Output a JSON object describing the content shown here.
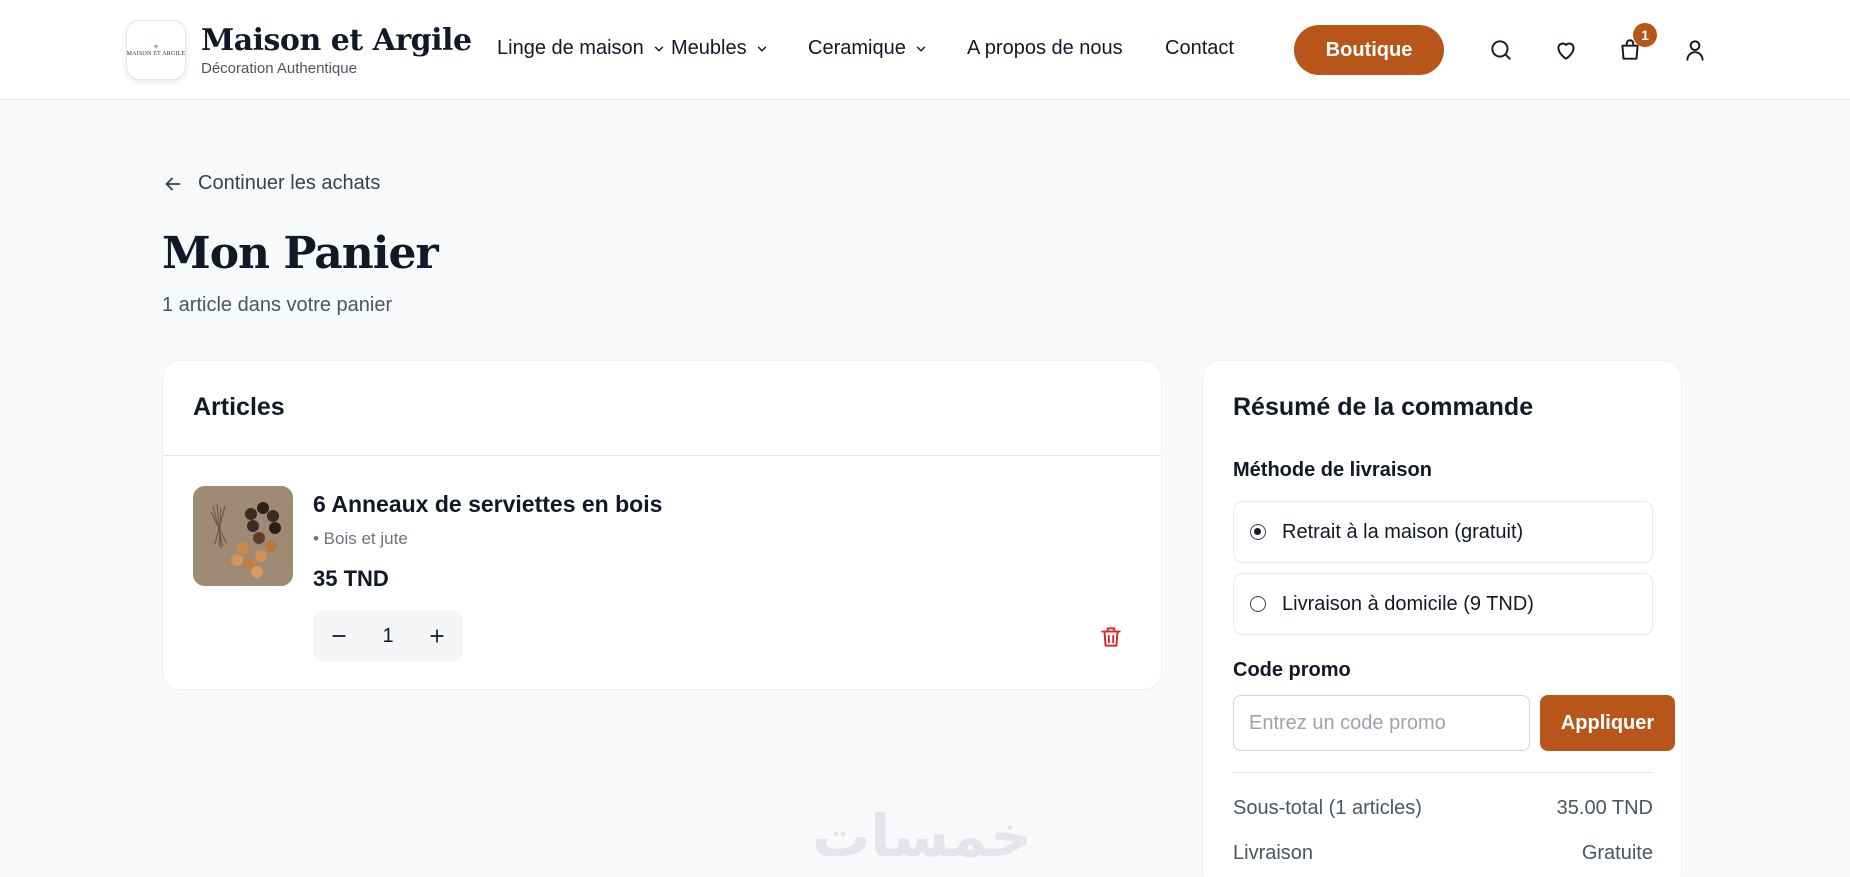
{
  "header": {
    "logo_mark": "MAISON ET ARGILE",
    "brand_name": "Maison et Argile",
    "brand_tagline": "Décoration Authentique",
    "nav": [
      {
        "label": "Linge de maison"
      },
      {
        "label": "Meubles"
      },
      {
        "label": "Ceramique"
      },
      {
        "label": "A propos de nous"
      },
      {
        "label": "Contact"
      }
    ],
    "shop_button": "Boutique",
    "cart_count": "1",
    "icons": [
      "search-icon",
      "heart-icon",
      "shopping-bag-icon",
      "user-icon"
    ]
  },
  "page": {
    "back_link": "Continuer les achats",
    "title": "Mon Panier",
    "subtitle": "1 article dans votre panier"
  },
  "articles": {
    "heading": "Articles",
    "items": [
      {
        "name": "6 Anneaux de serviettes en bois",
        "variant": "• Bois et jute",
        "price": "35 TND",
        "quantity": "1"
      }
    ]
  },
  "summary": {
    "title": "Résumé de la commande",
    "shipping_label": "Méthode de livraison",
    "shipping_options": [
      {
        "label": "Retrait à la maison (gratuit)",
        "selected": true
      },
      {
        "label": "Livraison à domicile (9 TND)",
        "selected": false
      }
    ],
    "promo_label": "Code promo",
    "promo_placeholder": "Entrez un code promo",
    "apply_button": "Appliquer",
    "rows": [
      {
        "label": "Sous-total (1 articles)",
        "value": "35.00 TND"
      },
      {
        "label": "Livraison",
        "value": "Gratuite"
      }
    ]
  },
  "watermark": "خمسات",
  "colors": {
    "accent": "#b8561a",
    "danger": "#dc2626",
    "text": "#111827",
    "muted": "#4b5563",
    "background": "#f8f9fb"
  }
}
